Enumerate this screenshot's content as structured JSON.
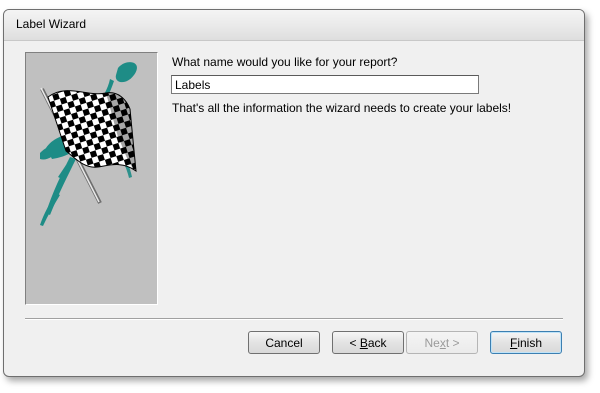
{
  "window": {
    "title": "Label Wizard"
  },
  "content": {
    "question": "What name would you like for your report?",
    "report_name_value": "Labels",
    "info_text": "That's all the information the wizard needs to create your labels!"
  },
  "buttons": {
    "cancel": "Cancel",
    "back_prefix": "< ",
    "back_accel": "B",
    "back_rest": "ack",
    "next_prefix": "Ne",
    "next_accel": "x",
    "next_rest": "t >",
    "finish_accel": "F",
    "finish_rest": "inish"
  },
  "colors": {
    "panel_gray": "#c0c0c0",
    "teal_brush": "#1e8c86"
  },
  "icons": {
    "wizard_art": "checkered-flag-icon"
  }
}
